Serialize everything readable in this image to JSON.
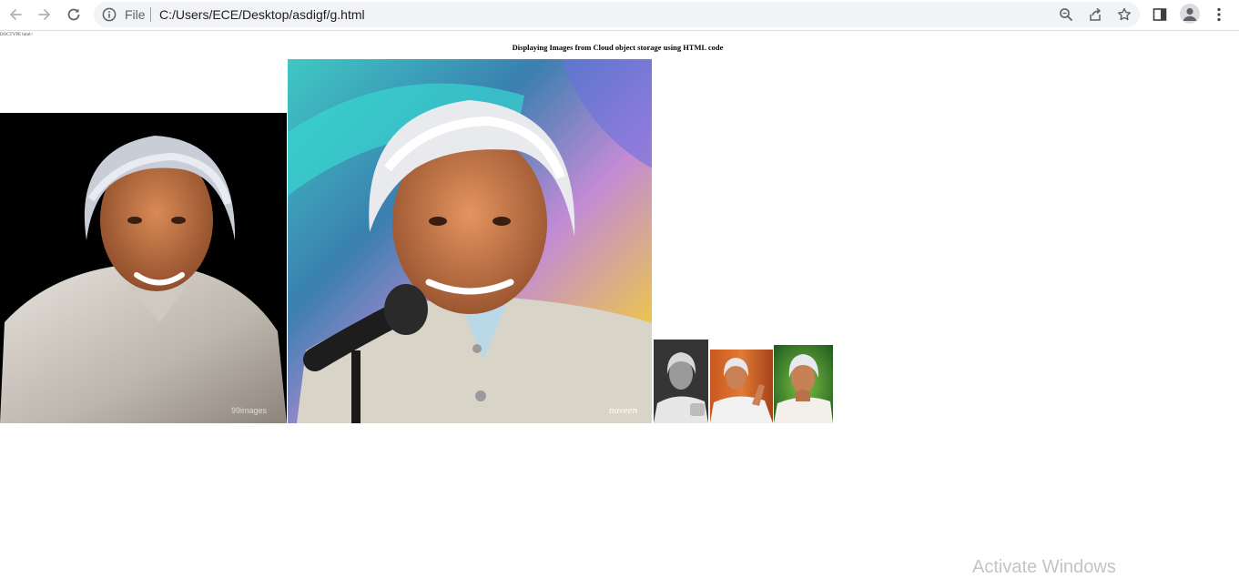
{
  "browser": {
    "scheme_label": "File",
    "url": "C:/Users/ECE/Desktop/asdigf/g.html",
    "icons": [
      "back-arrow-icon",
      "forward-arrow-icon",
      "reload-icon",
      "info-icon",
      "zoom-icon",
      "share-icon",
      "bookmark-star-icon",
      "side-panel-icon",
      "profile-icon",
      "menu-dots-icon"
    ]
  },
  "page": {
    "doctype_text": "DOCTYPE html>",
    "heading": "Displaying Images from Cloud object storage using HTML code",
    "images": [
      {
        "name": "portrait-smiling-black-background",
        "watermark": "99images"
      },
      {
        "name": "portrait-painted-microphone",
        "signature": "naveen"
      },
      {
        "name": "portrait-black-and-white"
      },
      {
        "name": "portrait-speaking-orange-curtain"
      },
      {
        "name": "portrait-hand-on-chin-green"
      }
    ]
  },
  "os_overlay": {
    "activate_windows": "Activate Windows"
  },
  "colors": {
    "toolbar_icon": "#5f6368",
    "omnibox_bg": "#f1f3f4"
  }
}
